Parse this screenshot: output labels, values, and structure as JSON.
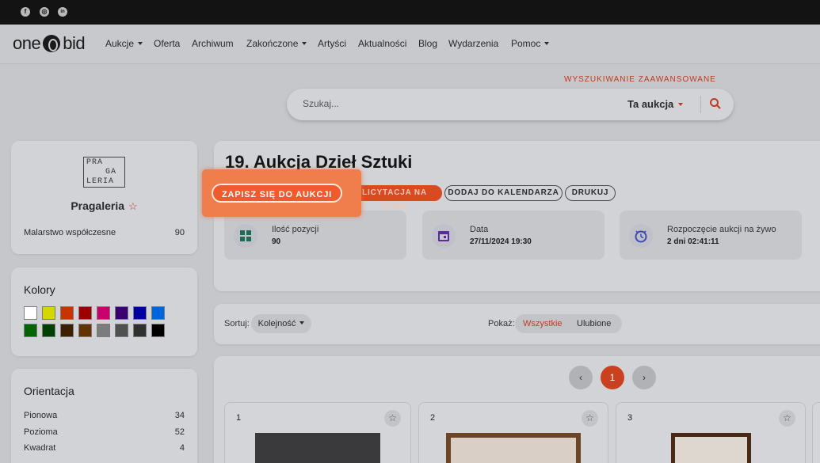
{
  "social": {
    "facebook": "f",
    "instagram": "◎",
    "linkedin": "in"
  },
  "logo": {
    "left": "one",
    "right": "bid"
  },
  "nav": [
    "Aukcje",
    "Oferta",
    "Archiwum",
    "Zakończone",
    "Artyści",
    "Aktualności",
    "Blog",
    "Wydarzenia",
    "Pomoc"
  ],
  "advanced_search": "WYSZUKIWANIE ZAAWANSOWANE",
  "search": {
    "placeholder": "Szukaj...",
    "scope": "Ta aukcja"
  },
  "gallery": {
    "logo_line1": "PRA",
    "logo_line2": "GA",
    "logo_line3": "LERIA",
    "name": "Pragaleria",
    "category": "Malarstwo współczesne",
    "count": "90"
  },
  "colors": {
    "title": "Kolory",
    "swatches": [
      "#ffffff",
      "#d4d800",
      "#c83400",
      "#9c0000",
      "#c8006e",
      "#3c006e",
      "#0000a0",
      "#0064dc",
      "#006400",
      "#004000",
      "#3c2000",
      "#643200",
      "#7c7c7c",
      "#505050",
      "#303030",
      "#000000"
    ]
  },
  "orientation": {
    "title": "Orientacja",
    "items": [
      {
        "label": "Pionowa",
        "count": "34"
      },
      {
        "label": "Pozioma",
        "count": "52"
      },
      {
        "label": "Kwadrat",
        "count": "4"
      }
    ]
  },
  "auction": {
    "title": "19. Aukcja Dzieł Sztuki",
    "cta": "ZAPISZ SIĘ DO AUKCJI",
    "live_bid": "LICYTACJA NA ŻYWO",
    "add_calendar": "DODAJ DO KALENDARZA",
    "print": "DRUKUJ",
    "info": [
      {
        "label": "Ilość pozycji",
        "value": "90"
      },
      {
        "label": "Data",
        "value": "27/11/2024 19:30"
      },
      {
        "label": "Rozpoczęcie aukcji na żywo",
        "value": "2 dni 02:41:11"
      }
    ]
  },
  "sort": {
    "label": "Sortuj:",
    "value": "Kolejność",
    "show_label": "Pokaż:",
    "show_all": "Wszystkie",
    "show_fav": "Ulubione"
  },
  "pagination": {
    "prev": "‹",
    "current": "1",
    "next": "›"
  },
  "lots": [
    {
      "num": "1"
    },
    {
      "num": "2"
    },
    {
      "num": "3"
    }
  ]
}
